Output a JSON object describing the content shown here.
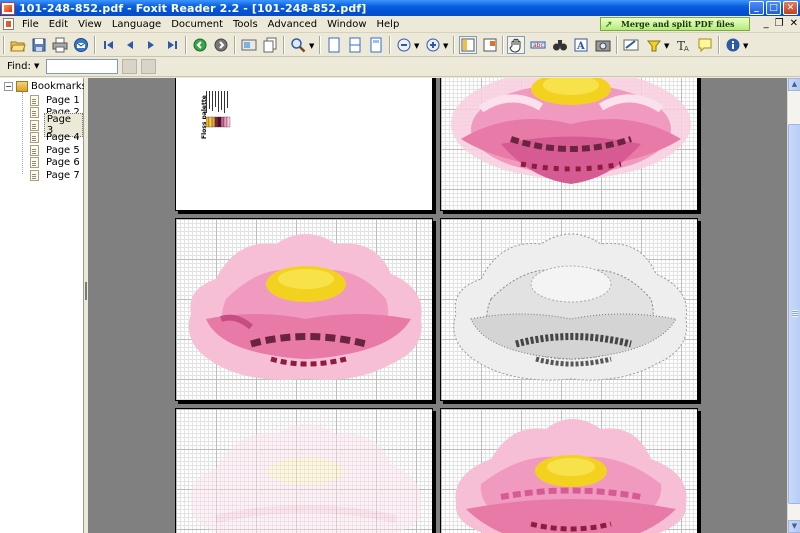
{
  "window": {
    "title": "101-248-852.pdf - Foxit Reader 2.2 - [101-248-852.pdf]",
    "controls": [
      "minimize",
      "maximize",
      "close"
    ]
  },
  "menu": {
    "items": [
      "File",
      "Edit",
      "View",
      "Language",
      "Document",
      "Tools",
      "Advanced",
      "Window",
      "Help"
    ],
    "promo": "Merge and split PDF files"
  },
  "toolbar": {
    "buttons": [
      "open-icon",
      "save-icon",
      "print-icon",
      "email-icon",
      "first-page-icon",
      "previous-page-icon",
      "next-page-icon",
      "last-page-icon",
      "go-back-icon",
      "go-forward-icon",
      "zoom-icon",
      "single-page-icon",
      "continuous-icon",
      "facing-icon",
      "zoom-out-icon",
      "zoom-in-icon",
      "bookmarks-panel-icon",
      "thumbnails-icon",
      "hand-tool-icon",
      "text-select-icon",
      "find-icon",
      "typewriter-icon",
      "snapshot-icon",
      "pen-icon",
      "highlight-icon",
      "text-icon",
      "note-icon",
      "info-icon"
    ]
  },
  "find": {
    "label": "Find:",
    "value": ""
  },
  "bookmarks": {
    "root": "Bookmarks",
    "items": [
      {
        "label": "Page 1"
      },
      {
        "label": "Page 2"
      },
      {
        "label": "Page 3",
        "selected": true
      },
      {
        "label": "Page 4"
      },
      {
        "label": "Page 5"
      },
      {
        "label": "Page 6"
      },
      {
        "label": "Page 7"
      }
    ]
  },
  "document": {
    "palette_title": "Floss palette",
    "palette_colors": [
      "#f4b324",
      "#f7d24a",
      "#e0a53a",
      "#8c1d3d",
      "#3a1a2a",
      "#d65b93",
      "#f29ac0",
      "#f8c6dc"
    ]
  },
  "colors": {
    "titlebar": "#0a5fdd",
    "doc_background": "#808080",
    "flower_pink": "#e87aa8",
    "flower_light_pink": "#f6bfd5",
    "flower_dark": "#6b2440",
    "flower_yellow": "#f3d21f"
  }
}
